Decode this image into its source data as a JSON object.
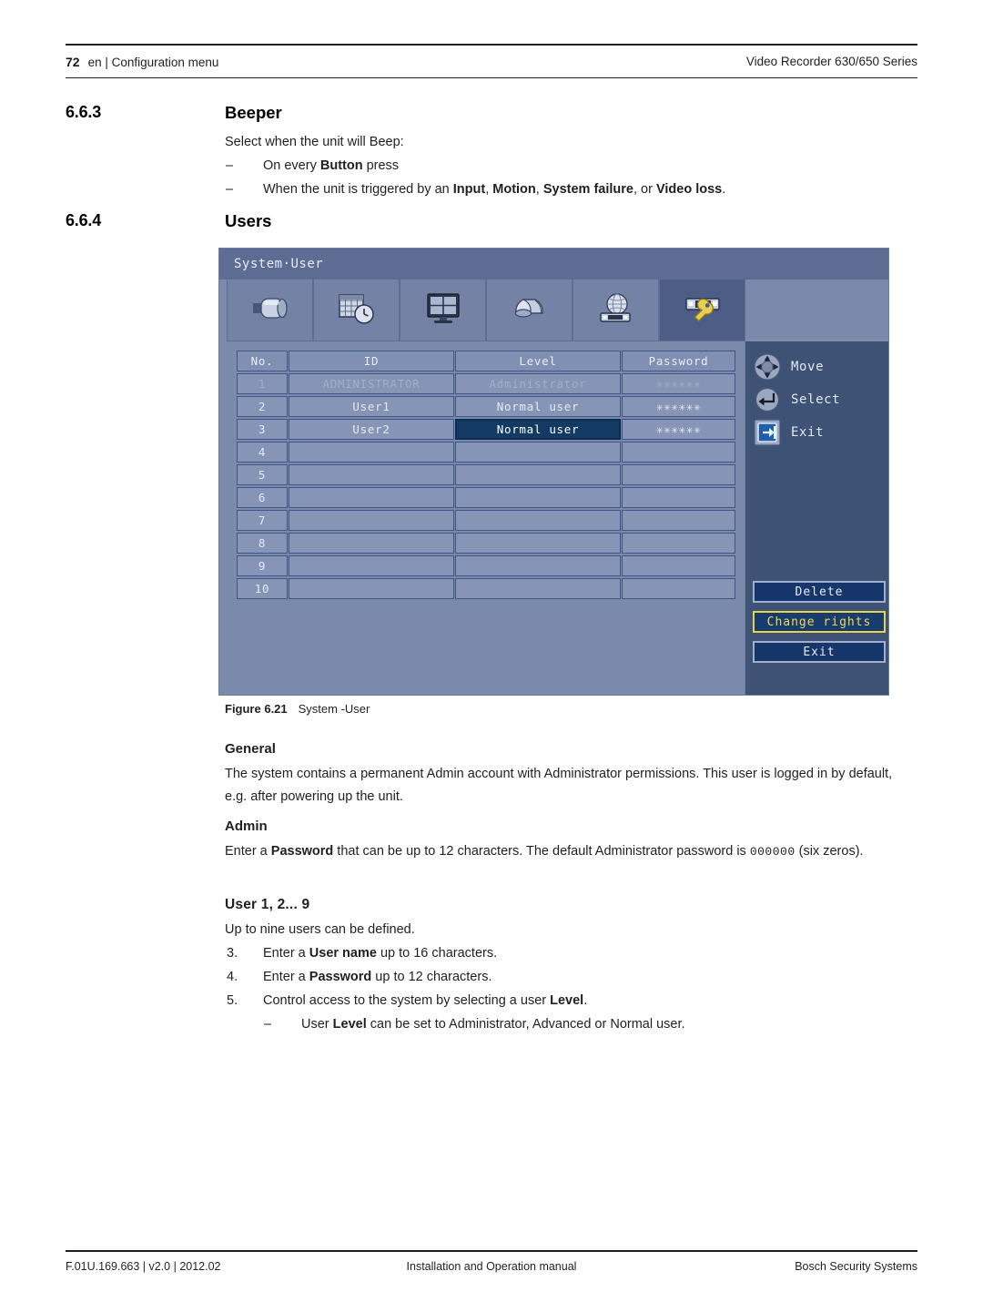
{
  "header": {
    "page_number": "72",
    "left_text": "en | Configuration menu",
    "right_text": "Video Recorder 630/650 Series"
  },
  "footer": {
    "left": "F.01U.169.663 | v2.0 | 2012.02",
    "center": "Installation and Operation manual",
    "right": "Bosch Security Systems"
  },
  "sections": {
    "beeper": {
      "number": "6.6.3",
      "title": "Beeper",
      "intro": "Select when the unit will Beep:",
      "bullets": [
        {
          "dash": "–",
          "parts": [
            "On every ",
            "Button",
            " press"
          ]
        },
        {
          "dash": "–",
          "parts": [
            "When the unit is triggered by an ",
            "Input",
            ", ",
            "Motion",
            ", ",
            "System failure",
            ", or ",
            "Video loss",
            "."
          ]
        }
      ]
    },
    "users": {
      "number": "6.6.4",
      "title": "Users"
    }
  },
  "figure": {
    "label": "Figure 6.21",
    "caption": "System -User"
  },
  "general": {
    "heading": "General",
    "text": "The system contains a permanent Admin account with Administrator permissions. This user is logged in by default, e.g. after powering up the unit."
  },
  "admin": {
    "heading": "Admin",
    "line1_a": "Enter a ",
    "line1_b": "Password",
    "line1_c": " that can be up to 12 characters. The default Administrator password is ",
    "password_default": "000000",
    "line1_d": " (six zeros)."
  },
  "users_detail": {
    "heading": "User 1, 2... 9",
    "intro": "Up to nine users can be defined.",
    "steps": [
      {
        "num": "3.",
        "a": "Enter a ",
        "b": "User name",
        "c": " up to 16 characters."
      },
      {
        "num": "4.",
        "a": "Enter a ",
        "b": "Password",
        "c": " up to 12 characters."
      },
      {
        "num": "5.",
        "a": "Control access to the system by selecting a user ",
        "b": "Level",
        "c": "."
      }
    ],
    "sub_bullet": {
      "dash": "–",
      "a": "User ",
      "b": "Level",
      "c": " can be set to Administrator, Advanced or Normal user."
    }
  },
  "dvr": {
    "title": "System·User",
    "toolbar": [
      {
        "name": "camera-icon",
        "label": "Camera",
        "selected": false
      },
      {
        "name": "schedule-icon",
        "label": "Schedule",
        "selected": false
      },
      {
        "name": "display-icon",
        "label": "Display",
        "selected": false
      },
      {
        "name": "alarm-icon",
        "label": "Alarm",
        "selected": false
      },
      {
        "name": "network-icon",
        "label": "Network",
        "selected": false
      },
      {
        "name": "system-icon",
        "label": "System",
        "selected": true
      }
    ],
    "table": {
      "columns": [
        "No.",
        "ID",
        "Level",
        "Password"
      ],
      "rows": [
        {
          "no": "1",
          "id": "ADMINISTRATOR",
          "level": "Administrator",
          "password": "✳✳✳✳✳✳",
          "disabled": true,
          "level_selected": false
        },
        {
          "no": "2",
          "id": "User1",
          "level": "Normal user",
          "password": "✳✳✳✳✳✳",
          "disabled": false,
          "level_selected": false
        },
        {
          "no": "3",
          "id": "User2",
          "level": "Normal user",
          "password": "✳✳✳✳✳✳",
          "disabled": false,
          "level_selected": true
        },
        {
          "no": "4",
          "id": "",
          "level": "",
          "password": "",
          "disabled": false,
          "level_selected": false
        },
        {
          "no": "5",
          "id": "",
          "level": "",
          "password": "",
          "disabled": false,
          "level_selected": false
        },
        {
          "no": "6",
          "id": "",
          "level": "",
          "password": "",
          "disabled": false,
          "level_selected": false
        },
        {
          "no": "7",
          "id": "",
          "level": "",
          "password": "",
          "disabled": false,
          "level_selected": false
        },
        {
          "no": "8",
          "id": "",
          "level": "",
          "password": "",
          "disabled": false,
          "level_selected": false
        },
        {
          "no": "9",
          "id": "",
          "level": "",
          "password": "",
          "disabled": false,
          "level_selected": false
        },
        {
          "no": "10",
          "id": "",
          "level": "",
          "password": "",
          "disabled": false,
          "level_selected": false
        }
      ]
    },
    "hints": [
      {
        "icon": "dpad-icon",
        "label": "Move"
      },
      {
        "icon": "enter-icon",
        "label": "Select"
      },
      {
        "icon": "exit-icon",
        "label": "Exit"
      }
    ],
    "buttons": [
      {
        "label": "Delete",
        "active": false
      },
      {
        "label": "Change rights",
        "active": true
      },
      {
        "label": "Exit",
        "active": false
      }
    ]
  },
  "colors": {
    "panel_bg": "#7b89ab",
    "titlebar": "#5e6c93",
    "side_panel": "#3d5274",
    "cell": "#8694b5",
    "cell_border": "#3f5588",
    "selection": "#123a63",
    "button_bg": "#16356b",
    "highlight_yellow": "#f2d94e",
    "ink": "#231f20"
  }
}
